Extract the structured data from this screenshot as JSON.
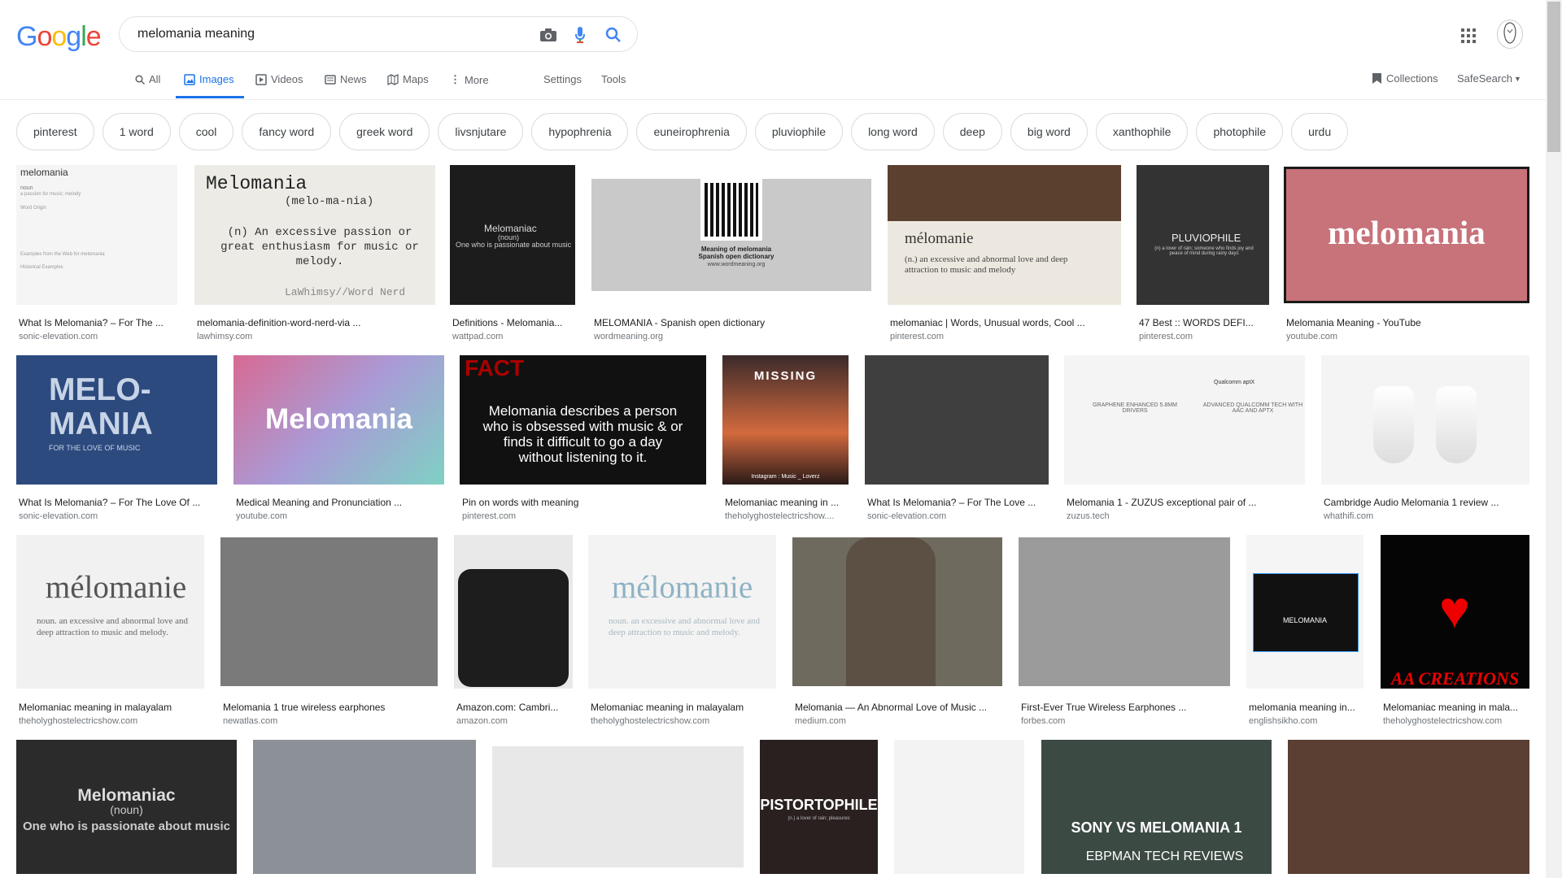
{
  "search": {
    "query": "melomania meaning"
  },
  "logo": "Google",
  "tabs": [
    {
      "label": "All",
      "icon": "search-icon"
    },
    {
      "label": "Images",
      "icon": "image-icon"
    },
    {
      "label": "Videos",
      "icon": "video-icon"
    },
    {
      "label": "News",
      "icon": "news-icon"
    },
    {
      "label": "Maps",
      "icon": "map-icon"
    },
    {
      "label": "More",
      "icon": "more-vert-icon"
    }
  ],
  "settings_label": "Settings",
  "tools_label": "Tools",
  "collections_label": "Collections",
  "safesearch_label": "SafeSearch",
  "chips": [
    "pinterest",
    "1 word",
    "cool",
    "fancy word",
    "greek word",
    "livsnjutare",
    "hypophrenia",
    "euneirophrenia",
    "pluviophile",
    "long word",
    "deep",
    "big word",
    "xanthophile",
    "photophile",
    "urdu"
  ],
  "results": [
    {
      "caption": "What Is Melomania? – For The ...",
      "source": "sonic-elevation.com"
    },
    {
      "caption": "melomania-definition-word-nerd-via ...",
      "source": "lawhimsy.com"
    },
    {
      "caption": "Definitions - Melomania...",
      "source": "wattpad.com"
    },
    {
      "caption": "MELOMANIA - Spanish open dictionary",
      "source": "wordmeaning.org"
    },
    {
      "caption": "melomaniac | Words, Unusual words, Cool ...",
      "source": "pinterest.com"
    },
    {
      "caption": "47 Best :: WORDS DEFI...",
      "source": "pinterest.com"
    },
    {
      "caption": "Melomania Meaning - YouTube",
      "source": "youtube.com"
    },
    {
      "caption": "What Is Melomania? – For The Love Of ...",
      "source": "sonic-elevation.com"
    },
    {
      "caption": "Medical Meaning and Pronunciation ...",
      "source": "youtube.com"
    },
    {
      "caption": "Pin on words with meaning",
      "source": "pinterest.com"
    },
    {
      "caption": "Melomaniac meaning in ...",
      "source": "theholyghostelectricshow...."
    },
    {
      "caption": "What Is Melomania? – For The Love ...",
      "source": "sonic-elevation.com"
    },
    {
      "caption": "Melomania 1 - ZUZUS exceptional pair of ...",
      "source": "zuzus.tech"
    },
    {
      "caption": "Cambridge Audio Melomania 1 review ...",
      "source": "whathifi.com"
    },
    {
      "caption": "Melomaniac meaning in malayalam",
      "source": "theholyghostelectricshow.com"
    },
    {
      "caption": "Melomania 1 true wireless earphones",
      "source": "newatlas.com"
    },
    {
      "caption": "Amazon.com: Cambri...",
      "source": "amazon.com"
    },
    {
      "caption": "Melomaniac meaning in malayalam",
      "source": "theholyghostelectricshow.com"
    },
    {
      "caption": "Melomania — An Abnormal Love of Music ...",
      "source": "medium.com"
    },
    {
      "caption": "First-Ever True Wireless Earphones ...",
      "source": "forbes.com"
    },
    {
      "caption": "melomania meaning in...",
      "source": "englishsikho.com"
    },
    {
      "caption": "Melomaniac meaning in mala...",
      "source": "theholyghostelectricshow.com"
    }
  ],
  "img_text": {
    "t1_title": "melomania",
    "t1_noun": "noun",
    "t1_def": "a passion for music; melody",
    "t1_wo": "Word Origin",
    "t1_ex": "Examples from the Web for melomania",
    "t1_hist": "Historical Examples",
    "t2_title": "Melomania",
    "t2_pron": "(melo-ma-nia)",
    "t2_def": "(n) An excessive passion or great enthusiasm for music or melody.",
    "t2_sig": "LaWhimsy//Word Nerd",
    "t3_title": "Melomaniac",
    "t3_sub": "(noun)",
    "t3_def": "One who is passionate about music",
    "t4_l1": "Meaning of melomania",
    "t4_l2": "Spanish open dictionary",
    "t4_l3": "www.wordmeaning.org",
    "t5_title": "mélomanie",
    "t5_def": "(n.) an excessive and abnormal love and deep attraction to music and melody",
    "t6_title": "PLUVIOPHILE",
    "t6_def": "(n) a lover of rain; someone who finds joy and peace of mind during rainy days",
    "t7_title": "melomania",
    "t8_l1": "MELO-",
    "t8_l2": "MANIA",
    "t8_l3": "FOR THE LOVE OF MUSIC",
    "t9_title": "Melomania",
    "t10_fact": "FACT",
    "t10_body": "Melomania describes a person who is obsessed with music & or finds it difficult to go a day without listening to it.",
    "t11_title": "MISSING",
    "t11_foot": "Instagram : Music _ Loverz",
    "t13_a": "GRAPHENE ENHANCED 5.8MM DRIVERS",
    "t13_b": "ADVANCED QUALCOMM TECH WITH AAC AND APTX",
    "t13_c": "Qualcomm aptX",
    "t15_title": "mélomanie",
    "t15_def": "noun. an excessive and abnormal love and deep attraction to music and melody.",
    "t18_title": "mélomanie",
    "t18_def": "noun. an excessive and abnormal love and deep attraction to music and melody.",
    "t21_title": "MELOMANIA",
    "t22_title": "AA CREATIONS",
    "r4a_title": "Melomaniac",
    "r4a_sub": "(noun)",
    "r4a_def": "One who is passionate about music",
    "r4d_title": "PISTORTOPHILE",
    "r4d_def": "(n.) a lover of rain; pleasures",
    "r4f_l1": "SONY VS MELOMANIA 1",
    "r4f_l2": "EBPMAN TECH REVIEWS"
  }
}
